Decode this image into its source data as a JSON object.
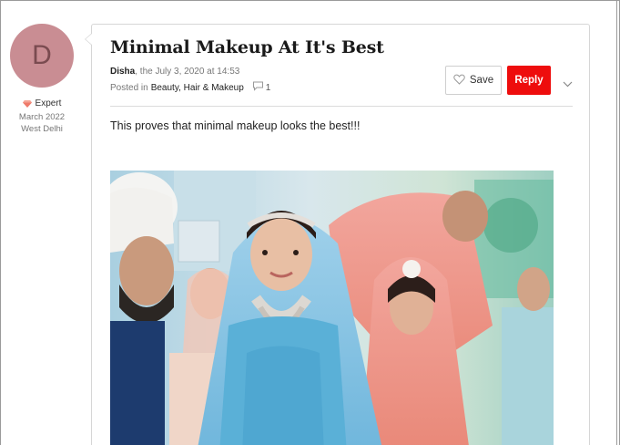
{
  "author": {
    "initial": "D",
    "role": "Expert",
    "joined": "March 2022",
    "location": "West Delhi",
    "avatar_color": "#c98d93"
  },
  "post": {
    "title": "Minimal Makeup At It's Best",
    "author_name": "Disha",
    "date_text": ", the July 3, 2020 at 14:53",
    "posted_in_label": "Posted in",
    "category": "Beauty, Hair & Makeup",
    "comment_count": "1",
    "body": "This proves that minimal makeup looks the best!!!"
  },
  "actions": {
    "save_label": "Save",
    "reply_label": "Reply",
    "reply_color": "#ee0d0d"
  },
  "icons": {
    "badge": "diamond-icon",
    "save": "heart-icon",
    "comment": "speech-bubble-icon",
    "more": "chevron-down-icon"
  }
}
